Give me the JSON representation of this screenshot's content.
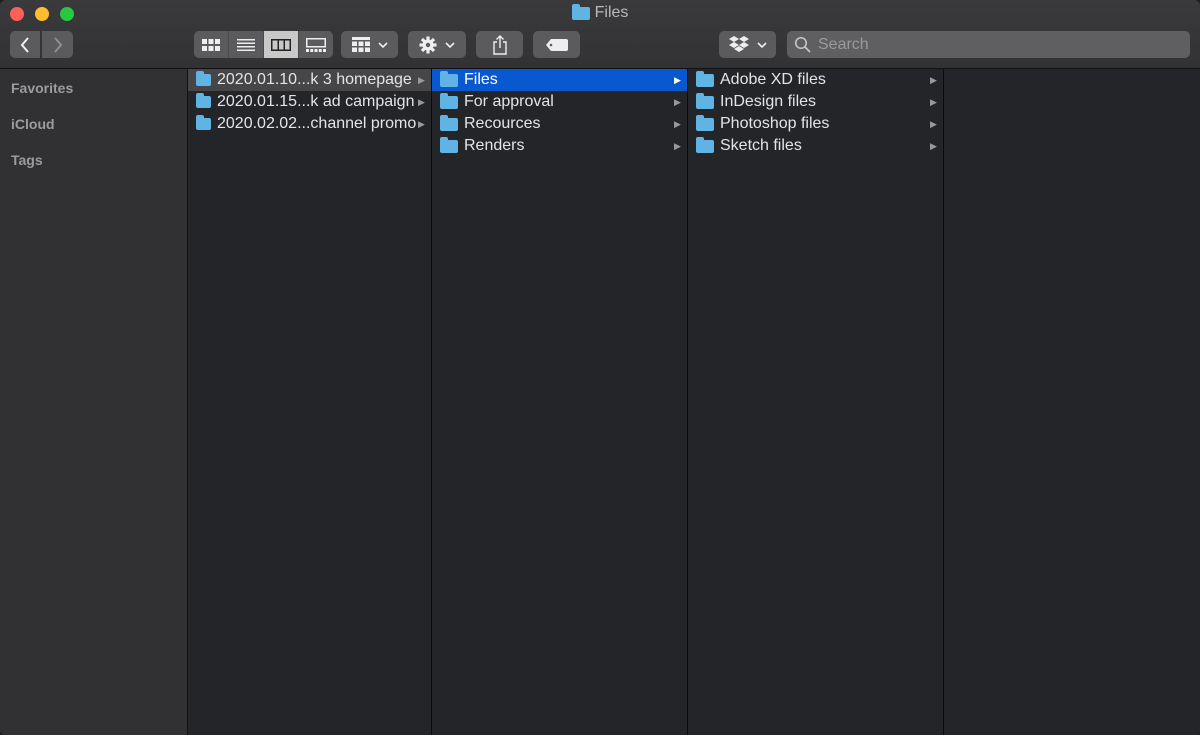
{
  "window": {
    "title": "Files",
    "title_icon": "folder-icon"
  },
  "toolbar": {
    "back_icon": "chevron-left-icon",
    "forward_icon": "chevron-right-icon",
    "view_modes": [
      "icon-view",
      "list-view",
      "column-view",
      "gallery-view"
    ],
    "active_view": "column-view",
    "group_icon": "group-grid-icon",
    "action_icon": "gear-icon",
    "share_icon": "share-icon",
    "tag_icon": "tag-icon",
    "dropbox_icon": "dropbox-icon",
    "search_placeholder": "Search",
    "search_value": ""
  },
  "sidebar": {
    "sections": [
      {
        "label": "Favorites"
      },
      {
        "label": "iCloud"
      },
      {
        "label": "Tags"
      }
    ]
  },
  "columns": [
    {
      "items": [
        {
          "name": "2020.01.10...k  3 homepage",
          "selected": "gray"
        },
        {
          "name": "2020.01.15...k ad campaign",
          "selected": ""
        },
        {
          "name": "2020.02.02...channel promo",
          "selected": ""
        }
      ]
    },
    {
      "items": [
        {
          "name": "Files",
          "selected": "blue"
        },
        {
          "name": "For approval",
          "selected": ""
        },
        {
          "name": "Recources",
          "selected": ""
        },
        {
          "name": "Renders",
          "selected": ""
        }
      ]
    },
    {
      "items": [
        {
          "name": "Adobe XD files",
          "selected": ""
        },
        {
          "name": "InDesign files",
          "selected": ""
        },
        {
          "name": "Photoshop files",
          "selected": ""
        },
        {
          "name": "Sketch files",
          "selected": ""
        }
      ]
    },
    {
      "items": []
    }
  ],
  "colors": {
    "selection_blue": "#0a58d0",
    "folder_blue": "#5fb4e4"
  }
}
